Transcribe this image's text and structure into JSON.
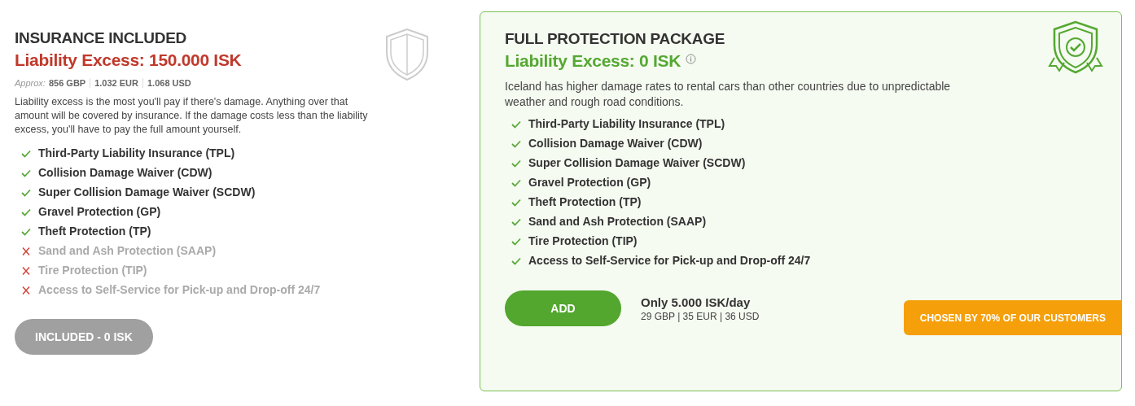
{
  "plans": [
    {
      "kind": "basic",
      "title": "INSURANCE INCLUDED",
      "excess": "Liability Excess: 150.000 ISK",
      "approx": {
        "label": "Approx:",
        "values": [
          "856 GBP",
          "1.032 EUR",
          "1.068 USD"
        ]
      },
      "description": "Liability excess is the most you'll pay if there's damage. Anything over that amount will be covered by insurance. If the damage costs less than the liability excess, you'll have to pay the full amount yourself.",
      "features": [
        {
          "label": "Third-Party Liability Insurance (TPL)",
          "included": true
        },
        {
          "label": "Collision Damage Waiver (CDW)",
          "included": true
        },
        {
          "label": "Super Collision Damage Waiver (SCDW)",
          "included": true
        },
        {
          "label": "Gravel Protection (GP)",
          "included": true
        },
        {
          "label": "Theft Protection (TP)",
          "included": true
        },
        {
          "label": "Sand and Ash Protection (SAAP)",
          "included": false
        },
        {
          "label": "Tire Protection (TIP)",
          "included": false
        },
        {
          "label": "Access to Self-Service for Pick-up and Drop-off 24/7",
          "included": false
        }
      ],
      "button": {
        "label": "INCLUDED - 0 ISK",
        "disabled": true
      }
    },
    {
      "kind": "full",
      "title": "FULL PROTECTION PACKAGE",
      "excess": "Liability Excess: 0 ISK",
      "description": "Iceland has higher damage rates to rental cars than other countries due to unpredictable weather and rough road conditions.",
      "features": [
        {
          "label": "Third-Party Liability Insurance (TPL)",
          "included": true
        },
        {
          "label": "Collision Damage Waiver (CDW)",
          "included": true
        },
        {
          "label": "Super Collision Damage Waiver (SCDW)",
          "included": true
        },
        {
          "label": "Gravel Protection (GP)",
          "included": true
        },
        {
          "label": "Theft Protection (TP)",
          "included": true
        },
        {
          "label": "Sand and Ash Protection (SAAP)",
          "included": true
        },
        {
          "label": "Tire Protection (TIP)",
          "included": true
        },
        {
          "label": "Access to Self-Service for Pick-up and Drop-off 24/7",
          "included": true
        }
      ],
      "button": {
        "label": "ADD",
        "disabled": false
      },
      "price": {
        "main": "Only 5.000 ISK/day",
        "sub": "29 GBP | 35 EUR | 36 USD"
      },
      "badge": "CHOSEN BY 70% OF OUR CUSTOMERS"
    }
  ]
}
